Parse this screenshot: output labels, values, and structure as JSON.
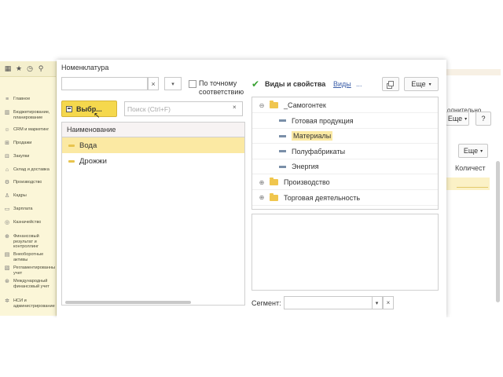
{
  "dialog": {
    "title": "Номенклатура",
    "exact_match_label_line1": "По точному",
    "exact_match_label_line2": "соответствию",
    "select_button": "Выбр...",
    "search_placeholder": "Поиск (Ctrl+F)",
    "grid": {
      "column_header": "Наименование",
      "rows": [
        {
          "label": "Вода",
          "selected": true
        },
        {
          "label": "Дрожжи",
          "selected": false
        }
      ]
    },
    "kinds": {
      "title": "Виды и свойства",
      "link": "Виды",
      "dots": "...",
      "more_button": "Еще",
      "tree": [
        {
          "label": "_Самогонтек",
          "type": "folder",
          "expanded": true
        },
        {
          "label": "Готовая продукция",
          "type": "item"
        },
        {
          "label": "Материалы",
          "type": "item",
          "selected": true
        },
        {
          "label": "Полуфабрикаты",
          "type": "item"
        },
        {
          "label": "Энергия",
          "type": "item"
        },
        {
          "label": "Производство",
          "type": "folder",
          "expanded": false
        },
        {
          "label": "Торговая деятельность",
          "type": "folder",
          "expanded": false
        }
      ]
    },
    "segment_label": "Сегмент:"
  },
  "sidebar": {
    "items": [
      {
        "label": "Главное",
        "icon": "list-icon"
      },
      {
        "label": "Бюджетирование, планирование",
        "icon": "chart-icon"
      },
      {
        "label": "CRM и маркетинг",
        "icon": "people-icon"
      },
      {
        "label": "Продажи",
        "icon": "cart-icon"
      },
      {
        "label": "Закупки",
        "icon": "basket-icon"
      },
      {
        "label": "Склад и доставка",
        "icon": "warehouse-icon"
      },
      {
        "label": "Производство",
        "icon": "factory-icon"
      },
      {
        "label": "Кадры",
        "icon": "person-icon"
      },
      {
        "label": "Зарплата",
        "icon": "wallet-icon"
      },
      {
        "label": "Казначейство",
        "icon": "coins-icon"
      },
      {
        "label": "Финансовый результат и контроллинг",
        "icon": "result-icon"
      },
      {
        "label": "Внеоборотные активы",
        "icon": "building-icon"
      },
      {
        "label": "Регламентированный учет",
        "icon": "report-icon"
      },
      {
        "label": "Международный финансовый учет",
        "icon": "globe-icon"
      },
      {
        "label": "НСИ и администрирование",
        "icon": "gear-icon"
      }
    ]
  },
  "background": {
    "partial_text": "олнительно",
    "more_button_1": "Еще",
    "help_button": "?",
    "more_button_2": "Еще",
    "column_partial": "Количест"
  }
}
